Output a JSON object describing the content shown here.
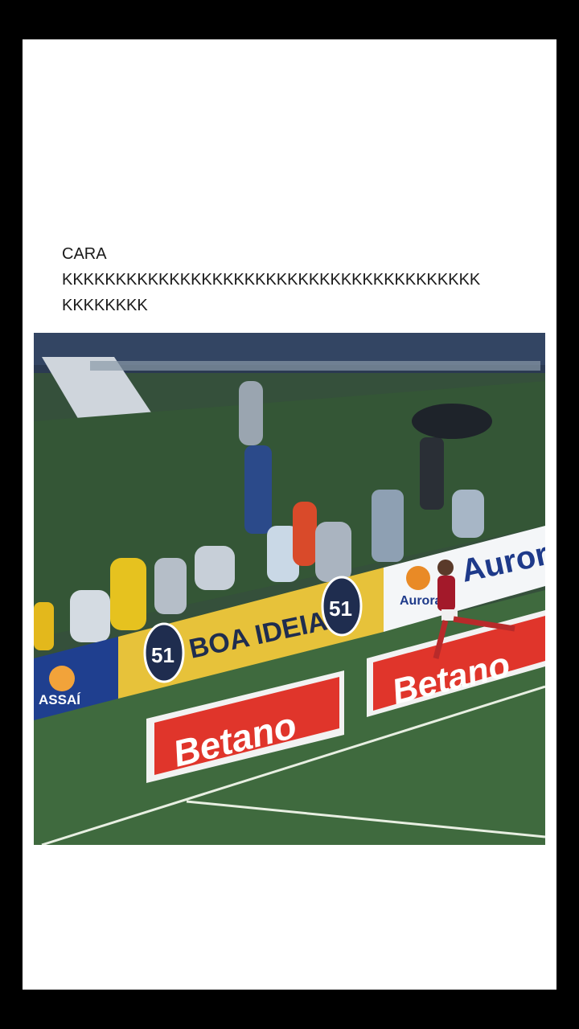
{
  "post": {
    "caption_line1": "CARA",
    "caption_line2": "KKKKKKKKKKKKKKKKKKKKKKKKKKKKKKKKKKKKKKK",
    "caption_line3": "KKKKKKKK"
  },
  "photo": {
    "ads": {
      "boa_ideia_number": "51",
      "boa_ideia_text": "BOA IDEIA",
      "aurora_text": "Aurora",
      "betano_text": "Betano",
      "assai_text": "ASSAÍ"
    }
  },
  "colors": {
    "frame": "#000000",
    "card": "#ffffff",
    "pitch": "#3f6a3e",
    "betano_red": "#e0352b",
    "boa_ideia_yellow": "#e7c23a",
    "assai_blue": "#1f3f8f"
  }
}
